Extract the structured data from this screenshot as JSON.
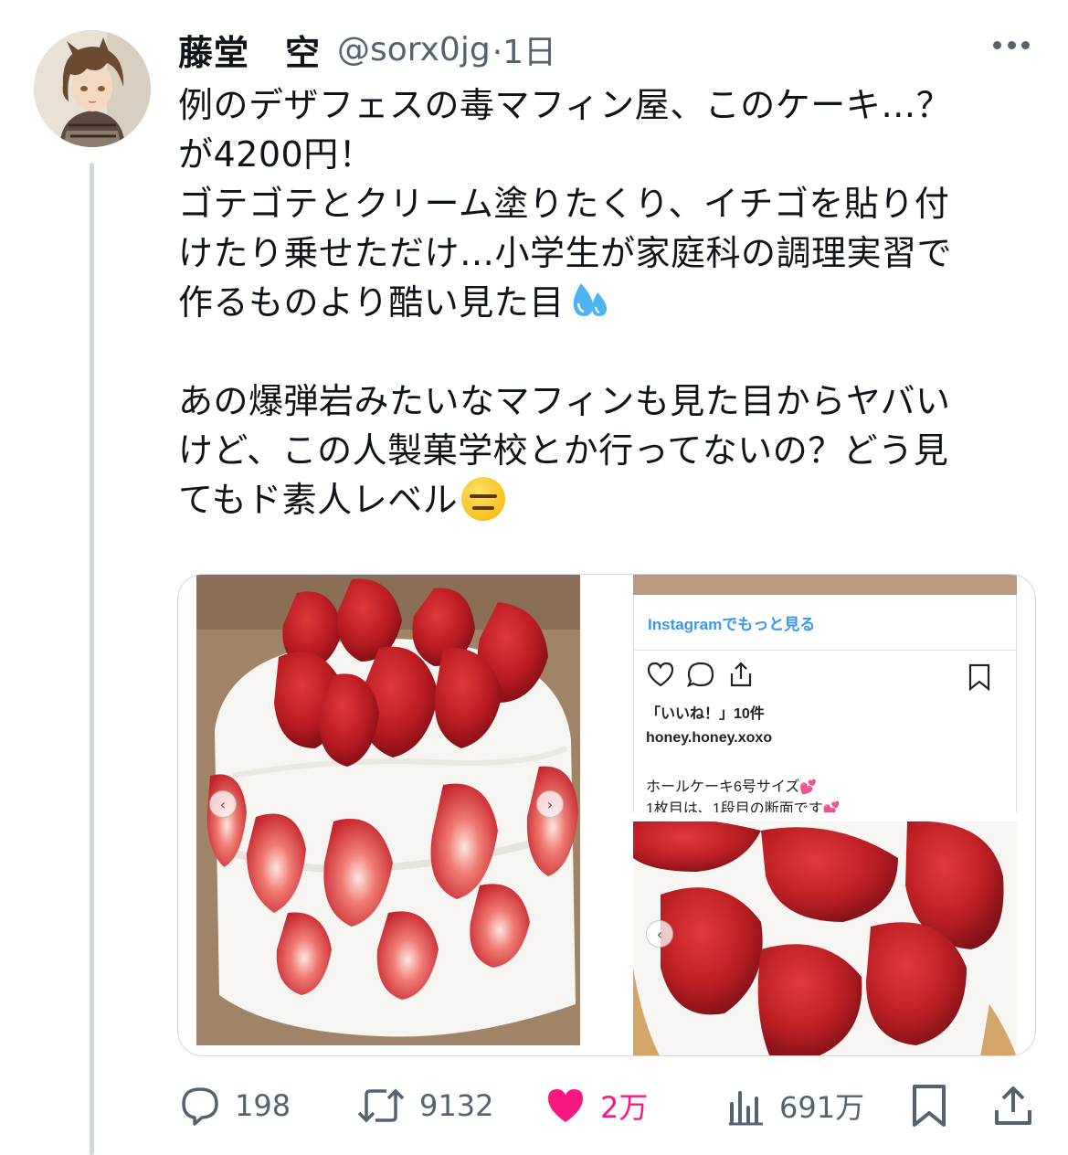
{
  "tweet": {
    "author": {
      "display_name": "藤堂　空",
      "handle": "@sorx0jg",
      "time": "·1日",
      "avatar_icon": "anime-avatar"
    },
    "text_lines": [
      "例のデザフェスの毒マフィン屋、このケーキ…？",
      "が4200円！",
      "ゴテゴテとクリーム塗りたくり、イチゴを貼り付",
      "けたり乗せただけ…小学生が家庭科の調理実習で",
      "作るものより酷い見た目",
      "",
      "あの爆弾岩みたいなマフィンも見た目からヤバい",
      "けど、この人製菓学校とか行ってないの？どう見",
      "てもド素人レベル"
    ],
    "emoji": [
      "sweat-droplets-emoji",
      "expressionless-face-emoji"
    ]
  },
  "media": {
    "left_image": "strawberry-cake-photo",
    "instagram": {
      "more_link": "Instagramでもっと見る",
      "likes": "「いいね！」10件",
      "username": "honey.honey.xoxo",
      "caption_line1": "ホールケーキ6号サイズ",
      "caption_line2": "1枚目は、1段目の断面です"
    },
    "right_bottom_image": "strawberry-top-photo"
  },
  "actions": {
    "reply_count": "198",
    "retweet_count": "9132",
    "like_count": "2万",
    "views_count": "691万"
  },
  "colors": {
    "text": "#0f1419",
    "secondary": "#536471",
    "like": "#f91880",
    "thread_line": "#cfd9de",
    "instagram_link": "#3897f0"
  }
}
